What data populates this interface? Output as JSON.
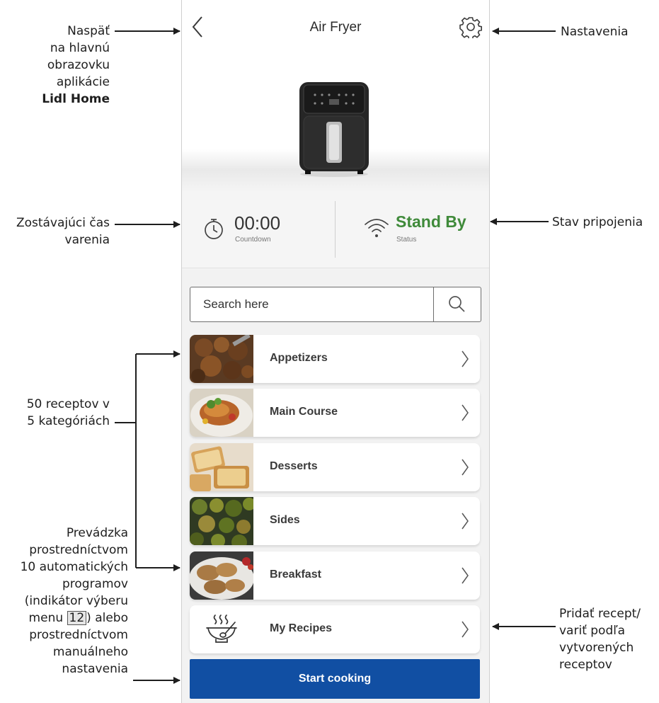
{
  "app": {
    "title": "Air Fryer",
    "back_icon": "chevron-left-icon",
    "settings_icon": "gear-icon"
  },
  "status": {
    "countdown_value": "00:00",
    "countdown_label": "Countdown",
    "countdown_icon": "timer-icon",
    "connection_value": "Stand By",
    "connection_label": "Status",
    "connection_icon": "wifi-icon",
    "connection_color": "#3f8a3a"
  },
  "search": {
    "placeholder": "Search here",
    "icon": "search-icon"
  },
  "categories": [
    {
      "label": "Appetizers"
    },
    {
      "label": "Main Course"
    },
    {
      "label": "Desserts"
    },
    {
      "label": "Sides"
    },
    {
      "label": "Breakfast"
    },
    {
      "label": "My Recipes",
      "icon": "soup-bowl-icon"
    }
  ],
  "start_button": {
    "label": "Start cooking",
    "color": "#114fa3"
  },
  "annotations": {
    "back_lines": [
      "Naspäť",
      "na hlavnú",
      "obrazovku",
      "aplikácie"
    ],
    "back_brand": "Lidl Home",
    "settings": "Nastavenia",
    "countdown_lines": [
      "Zostávajúci čas",
      "varenia"
    ],
    "connection": "Stav pripojenia",
    "recipes_lines": [
      "50 receptov v",
      "5 kategóriách"
    ],
    "programs_lines": [
      "Prevádzka",
      "prostredníctvom",
      "10 automatických",
      "programov",
      "(indikátor výberu"
    ],
    "programs_menu_pre": "menu ",
    "programs_menu_num": "12",
    "programs_menu_post": ") alebo",
    "programs_tail_lines": [
      "prostredníctvom",
      "manuálneho",
      "nastavenia"
    ],
    "myrecipes_lines": [
      "Pridať recept/",
      "variť podľa",
      "vytvorených",
      "receptov"
    ]
  }
}
